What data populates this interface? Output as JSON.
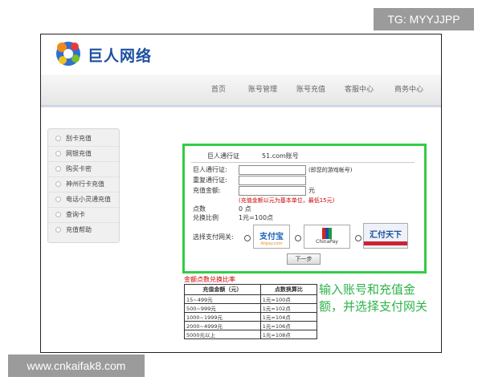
{
  "watermark_top": "TG: MYYJJPP",
  "watermark_bottom": "www.cnkaifak8.com",
  "brand": "巨人网络",
  "nav": [
    "首页",
    "账号管理",
    "账号充值",
    "客服中心",
    "商务中心"
  ],
  "sidebar": [
    "刮卡充值",
    "网银充值",
    "购买卡密",
    "神州行卡充值",
    "电话小灵通充值",
    "查询卡",
    "充值帮助"
  ],
  "form": {
    "tabs": [
      "巨人通行证",
      "51.com账号"
    ],
    "pass_label": "巨人通行证:",
    "pass_hint": "(即您的游戏帐号)",
    "repeat_label": "重复通行证:",
    "amount_label": "充值金额:",
    "amount_unit": "元",
    "amount_note": "(充值金额以元为基本单位，最低15元)",
    "points_label": "点数",
    "points_value": "0 点",
    "ratio_label": "兑换比例",
    "ratio_value": "1元=100点",
    "gateway_label": "选择支付网关:",
    "gateways": [
      "支付宝",
      "ChinaPay",
      "汇付天下"
    ],
    "next_button": "下一步"
  },
  "rate_table": {
    "title": "金额点数兑换比率",
    "headers": [
      "充值金额（元）",
      "点数换算比"
    ],
    "rows": [
      [
        "15~499元",
        "1元=100点"
      ],
      [
        "500~999元",
        "1元=102点"
      ],
      [
        "1000~1999元",
        "1元=104点"
      ],
      [
        "2000~4999元",
        "1元=106点"
      ],
      [
        "5000元以上",
        "1元=108点"
      ]
    ]
  },
  "annotation": "输入账号和充值金额，并选择支付网关",
  "colors": {
    "accent_green": "#33cc44",
    "brand_blue": "#1b4fa0",
    "warning_red": "#cc0000"
  }
}
